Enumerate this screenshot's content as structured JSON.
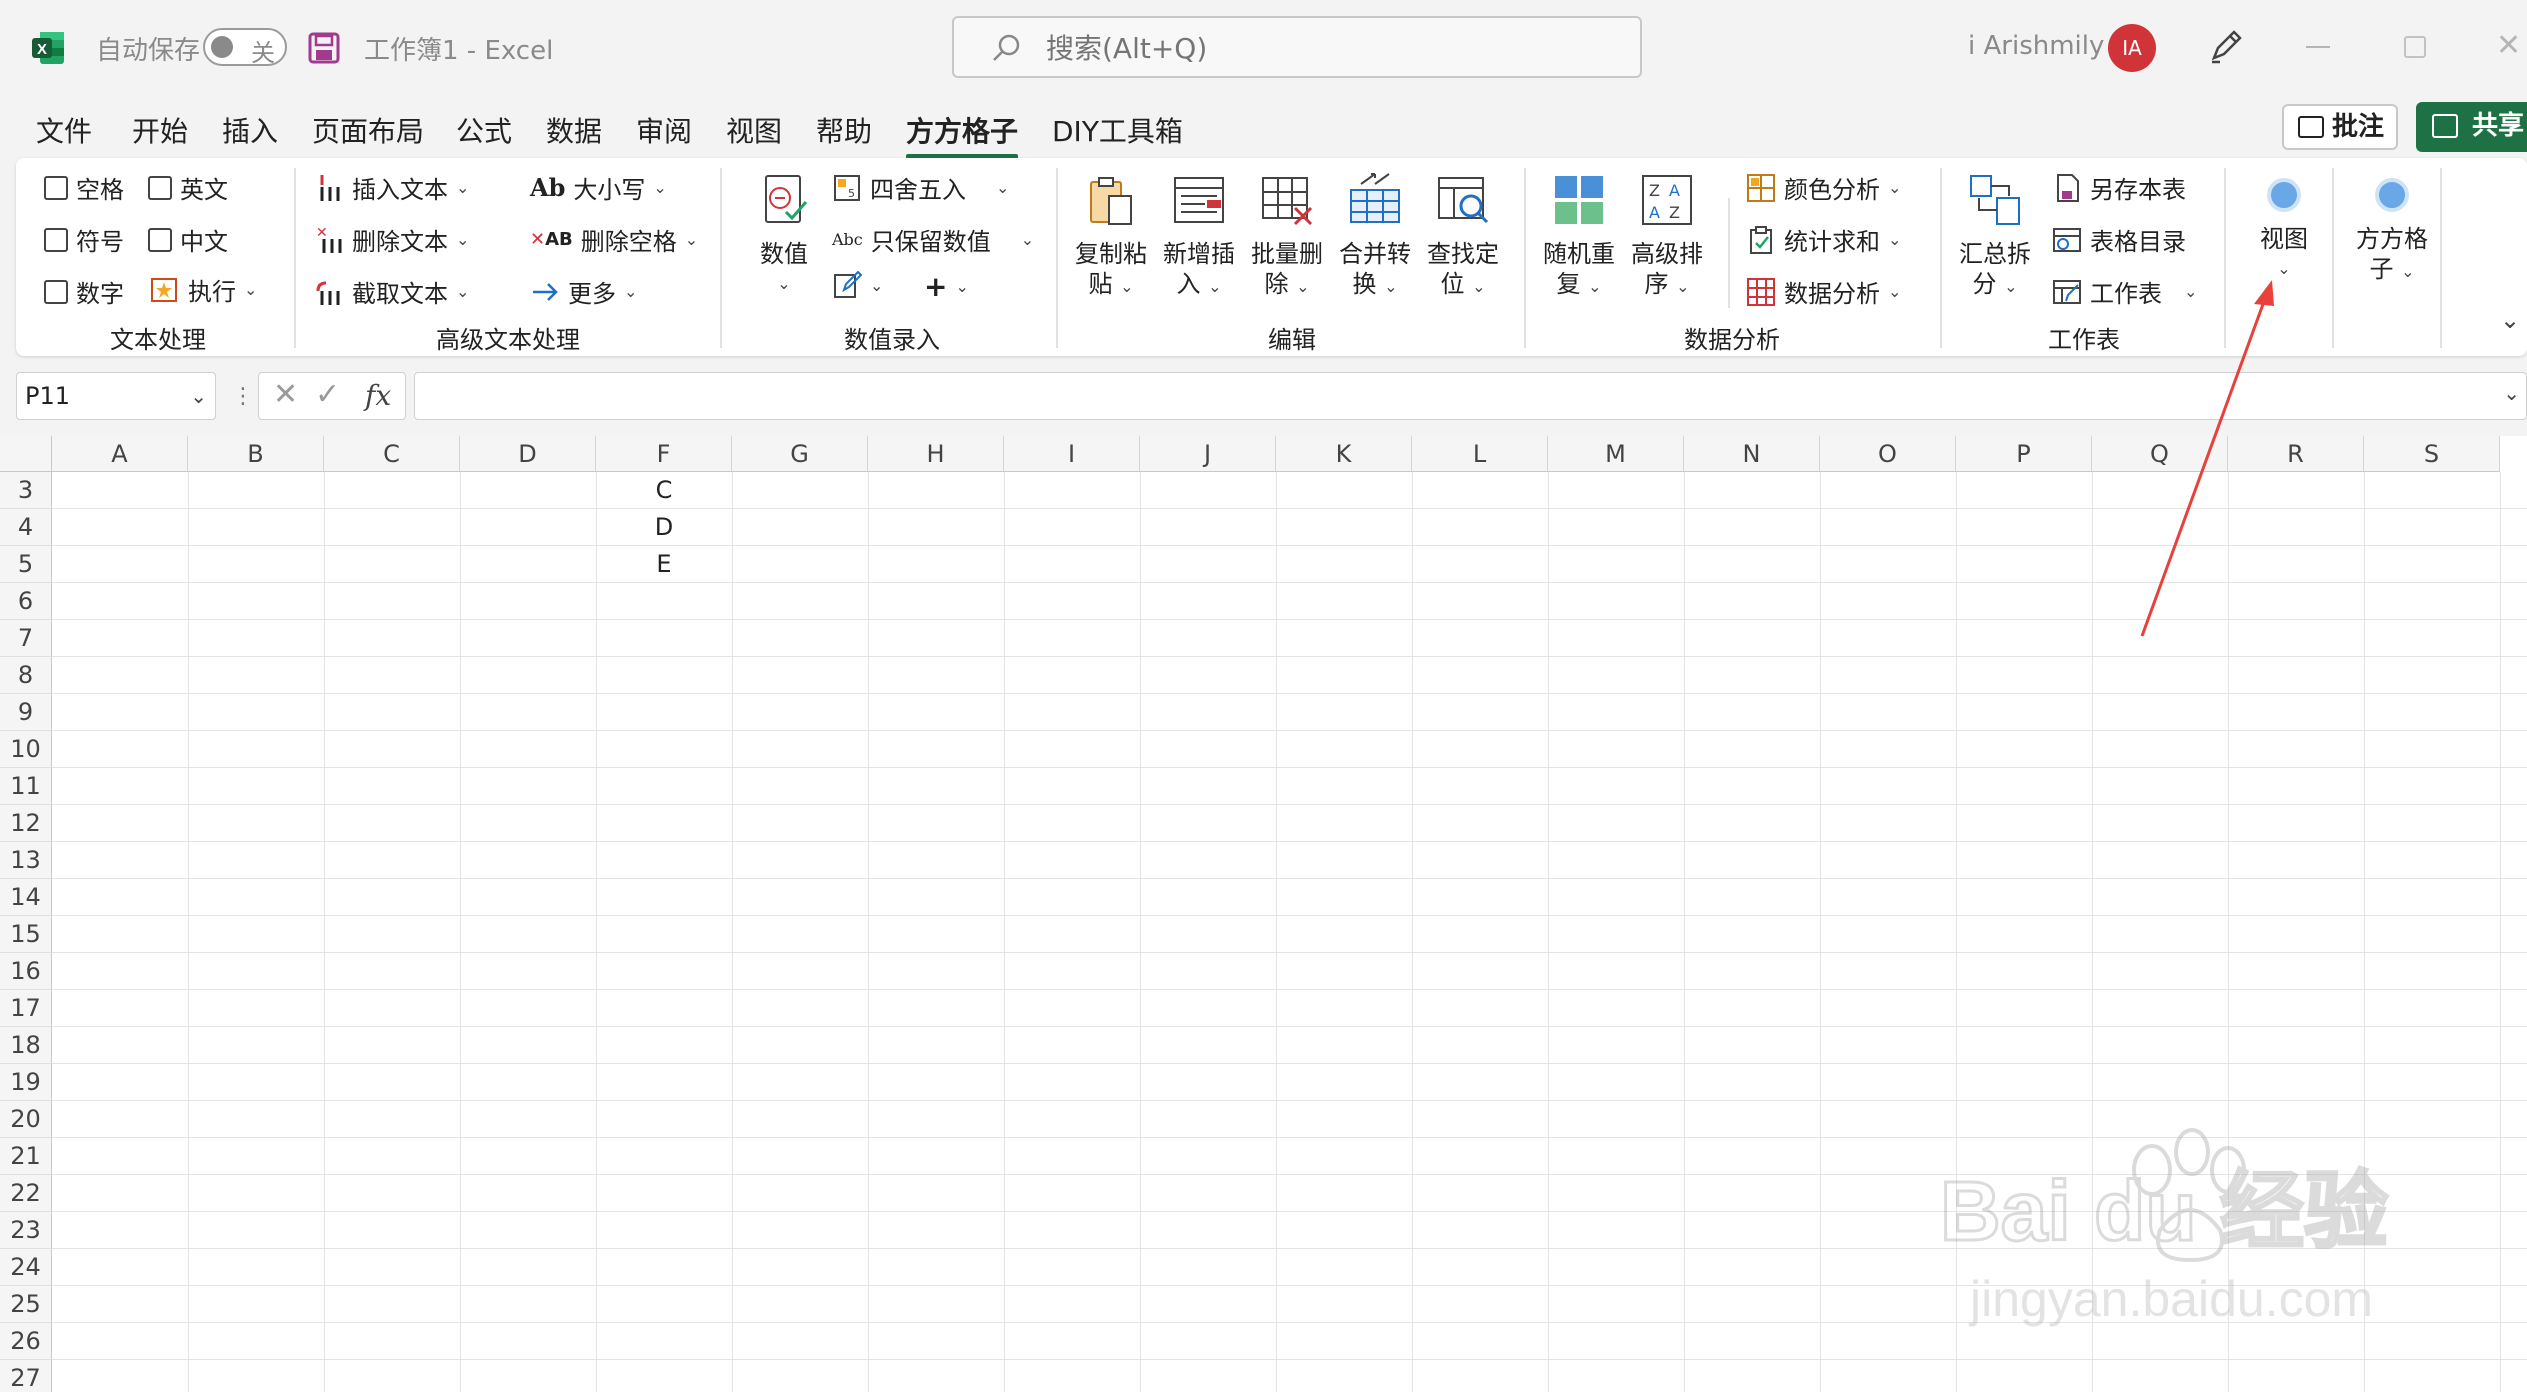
{
  "app": {
    "autosave_label": "自动保存",
    "toggle_state": "关",
    "doc_title": "工作簿1  -  Excel",
    "search_placeholder": "搜索(Alt+Q)",
    "username": "i Arishmily",
    "avatar_initials": "IA"
  },
  "menu": {
    "tabs": [
      "文件",
      "开始",
      "插入",
      "页面布局",
      "公式",
      "数据",
      "审阅",
      "视图",
      "帮助",
      "方方格子",
      "DIY工具箱"
    ],
    "active_tab": "方方格子",
    "comment_label": "批注",
    "share_label": "共享"
  },
  "ribbon": {
    "text_group": {
      "label": "文本处理",
      "items": [
        "空格",
        "英文",
        "符号",
        "中文",
        "数字",
        "执行"
      ]
    },
    "adv_text_group": {
      "label": "高级文本处理",
      "items": [
        "插入文本",
        "删除文本",
        "截取文本",
        "大小写",
        "删除空格",
        "更多"
      ]
    },
    "value_group": {
      "label": "数值录入",
      "big_label": "数值",
      "items": [
        "四舍五入",
        "只保留数值"
      ]
    },
    "edit_group": {
      "label": "编辑",
      "buttons": [
        {
          "line1": "复制粘",
          "line2": "贴"
        },
        {
          "line1": "新增插",
          "line2": "入"
        },
        {
          "line1": "批量删",
          "line2": "除"
        },
        {
          "line1": "合并转",
          "line2": "换"
        },
        {
          "line1": "查找定",
          "line2": "位"
        }
      ]
    },
    "analysis_group": {
      "label": "数据分析",
      "buttons": [
        {
          "line1": "随机重",
          "line2": "复"
        },
        {
          "line1": "高级排",
          "line2": "序"
        }
      ],
      "items": [
        "颜色分析",
        "统计求和",
        "数据分析"
      ]
    },
    "sheet_group": {
      "label": "工作表",
      "big": {
        "line1": "汇总拆",
        "line2": "分"
      },
      "items": [
        "另存本表",
        "表格目录",
        "工作表"
      ]
    },
    "view_btn": "视图",
    "ffgz_btn": {
      "line1": "方方格",
      "line2": "子"
    }
  },
  "formula": {
    "name_box": "P11",
    "fx": "fx",
    "value": ""
  },
  "grid": {
    "columns": [
      "A",
      "B",
      "C",
      "D",
      "F",
      "G",
      "H",
      "I",
      "J",
      "K",
      "L",
      "M",
      "N",
      "O",
      "P",
      "Q",
      "R",
      "S"
    ],
    "rows": [
      "3",
      "4",
      "5",
      "6",
      "7",
      "8",
      "9",
      "10",
      "11",
      "12",
      "13",
      "14",
      "15",
      "16",
      "17",
      "18",
      "19",
      "20",
      "21",
      "22",
      "23",
      "24",
      "25",
      "26",
      "27"
    ],
    "cells": [
      {
        "col": "F",
        "row": "3",
        "value": "C"
      },
      {
        "col": "F",
        "row": "4",
        "value": "D"
      },
      {
        "col": "F",
        "row": "5",
        "value": "E"
      }
    ]
  },
  "colors": {
    "excel_green": "#1e7145",
    "avatar_red": "#d13438",
    "arrow_red": "#e8403a",
    "accent_blue": "#6aa7e6"
  },
  "watermark": {
    "logo": "Bai du 经验",
    "url": "jingyan.baidu.com"
  }
}
